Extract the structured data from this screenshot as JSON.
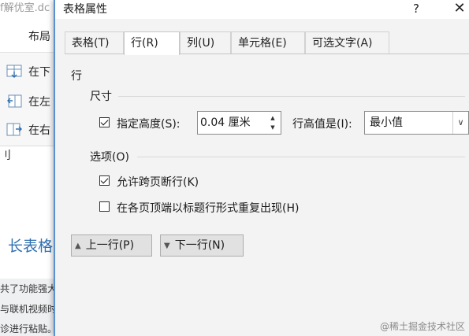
{
  "background": {
    "title_fragment": "f解优室.dc",
    "tab_label": "布局",
    "insert_rows": [
      {
        "label": "在下"
      },
      {
        "label": "在左"
      },
      {
        "label": "在右"
      }
    ],
    "side_label": "刂",
    "heading": "长表格",
    "text_lines": [
      "共了功能强大",
      "与联机视频时",
      "诊进行粘贴。"
    ]
  },
  "dialog": {
    "title": "表格属性",
    "help_label": "?",
    "close_label": "✕",
    "tabs": [
      {
        "label": "表格(T)",
        "active": false
      },
      {
        "label": "行(R)",
        "active": true
      },
      {
        "label": "列(U)",
        "active": false
      },
      {
        "label": "单元格(E)",
        "active": false
      },
      {
        "label": "可选文字(A)",
        "active": false
      }
    ],
    "section_label": "行",
    "size": {
      "group_title": "尺寸",
      "specify_height_label": "指定高度(S):",
      "specify_height_checked": true,
      "height_value": "0.04 厘米",
      "row_height_is_label": "行高值是(I):",
      "row_height_mode": "最小值"
    },
    "options": {
      "group_title": "选项(O)",
      "allow_break_label": "允许跨页断行(K)",
      "allow_break_checked": true,
      "repeat_header_label": "在各页顶端以标题行形式重复出现(H)",
      "repeat_header_checked": false
    },
    "buttons": {
      "prev_row": "上一行(P)",
      "next_row": "下一行(N)"
    }
  },
  "watermark": "@稀土掘金技术社区",
  "colors": {
    "accent_border": "#5a8fd0",
    "heading_blue": "#2e6fb0"
  }
}
